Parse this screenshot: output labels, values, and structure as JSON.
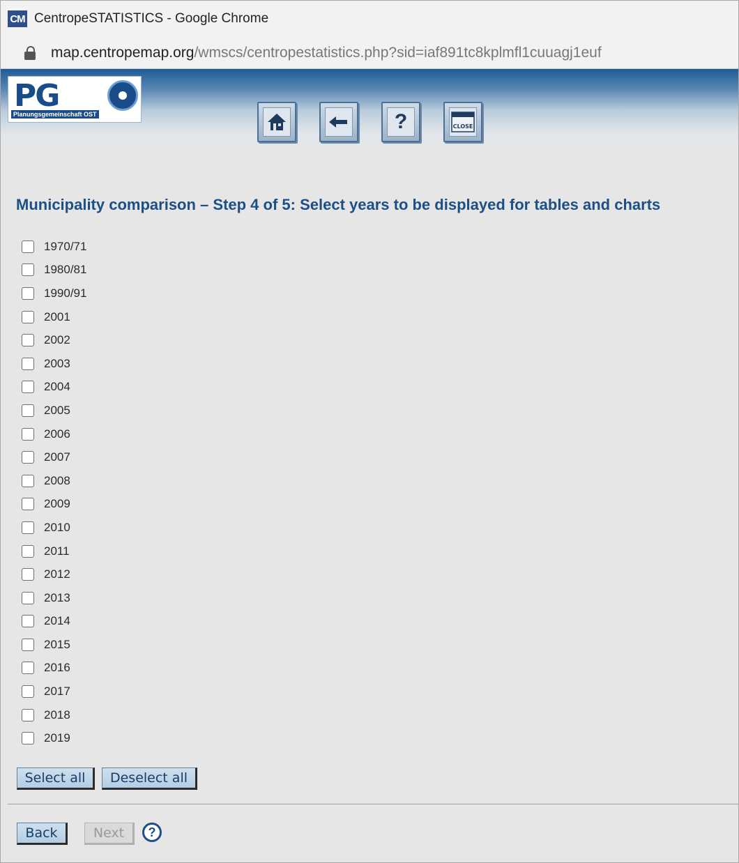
{
  "window": {
    "app_icon_text": "CM",
    "title": "CentropeSTATISTICS - Google Chrome"
  },
  "address_bar": {
    "url_host": "map.centropemap.org",
    "url_path": "/wmscs/centropestatistics.php?sid=iaf891tc8kplmfl1cuuagj1euf"
  },
  "header": {
    "logo_text": "PG",
    "logo_subtitle": "Planungsgemeinschaft OST",
    "toolbar": [
      {
        "name": "home-button",
        "icon": "home-icon",
        "glyph": "⌂"
      },
      {
        "name": "back-arrow-button",
        "icon": "left-arrow-icon",
        "glyph": "←"
      },
      {
        "name": "help-button",
        "icon": "question-icon",
        "glyph": "?"
      },
      {
        "name": "close-button",
        "icon": "close-window-icon",
        "glyph": "CLOSE"
      }
    ]
  },
  "main": {
    "heading": "Municipality comparison – Step 4 of 5: Select years to be displayed for tables and charts",
    "years": [
      "1970/71",
      "1980/81",
      "1990/91",
      "2001",
      "2002",
      "2003",
      "2004",
      "2005",
      "2006",
      "2007",
      "2008",
      "2009",
      "2010",
      "2011",
      "2012",
      "2013",
      "2014",
      "2015",
      "2016",
      "2017",
      "2018",
      "2019"
    ],
    "select_all_label": "Select all",
    "deselect_all_label": "Deselect all",
    "back_label": "Back",
    "next_label": "Next",
    "help_glyph": "?"
  },
  "colors": {
    "heading": "#1d4f87",
    "banner_top": "#1e5b96",
    "button_bg": "#b3cde3"
  }
}
